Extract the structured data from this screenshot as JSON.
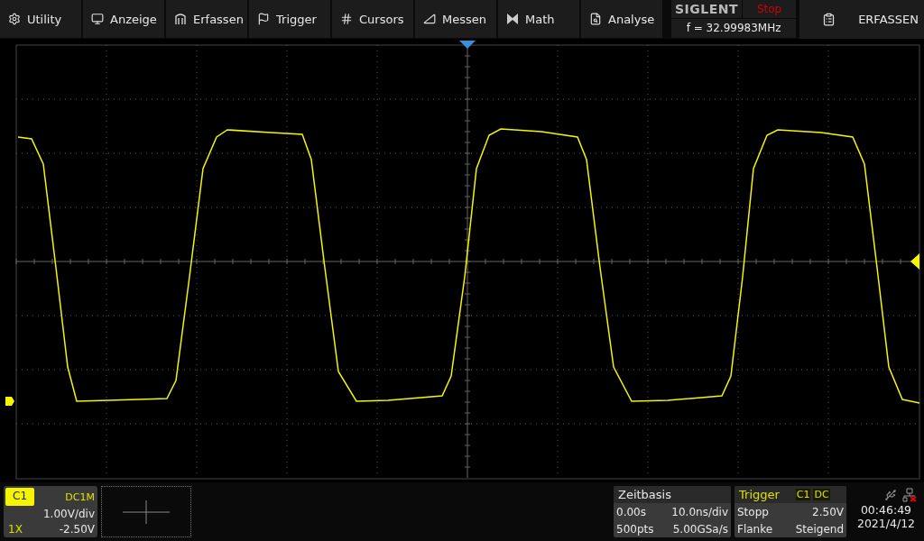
{
  "menu": [
    {
      "label": "Utility"
    },
    {
      "label": "Anzeige"
    },
    {
      "label": "Erfassen"
    },
    {
      "label": "Trigger"
    },
    {
      "label": "Cursors"
    },
    {
      "label": "Messen"
    },
    {
      "label": "Math"
    },
    {
      "label": "Analyse"
    }
  ],
  "brand": {
    "logo": "SIGLENT",
    "run_state": "Stop",
    "frequency": "f = 32.99983MHz"
  },
  "mode_button": {
    "label": "ERFASSEN"
  },
  "channel": {
    "name": "C1",
    "coupling": "DC1M",
    "scale": "1.00V/div",
    "probe": "1X",
    "offset": "-2.50V"
  },
  "timebase": {
    "title": "Zeitbasis",
    "delay": "0.00s",
    "scale": "10.0ns/div",
    "points": "500pts",
    "sample_rate": "5.00GSa/s"
  },
  "trigger": {
    "title": "Trigger",
    "source": "C1",
    "coupling": "DC",
    "mode": "Stopp",
    "level": "2.50V",
    "type": "Flanke",
    "slope": "Steigend"
  },
  "status": {
    "time": "00:46:49",
    "date": "2021/4/12"
  }
}
